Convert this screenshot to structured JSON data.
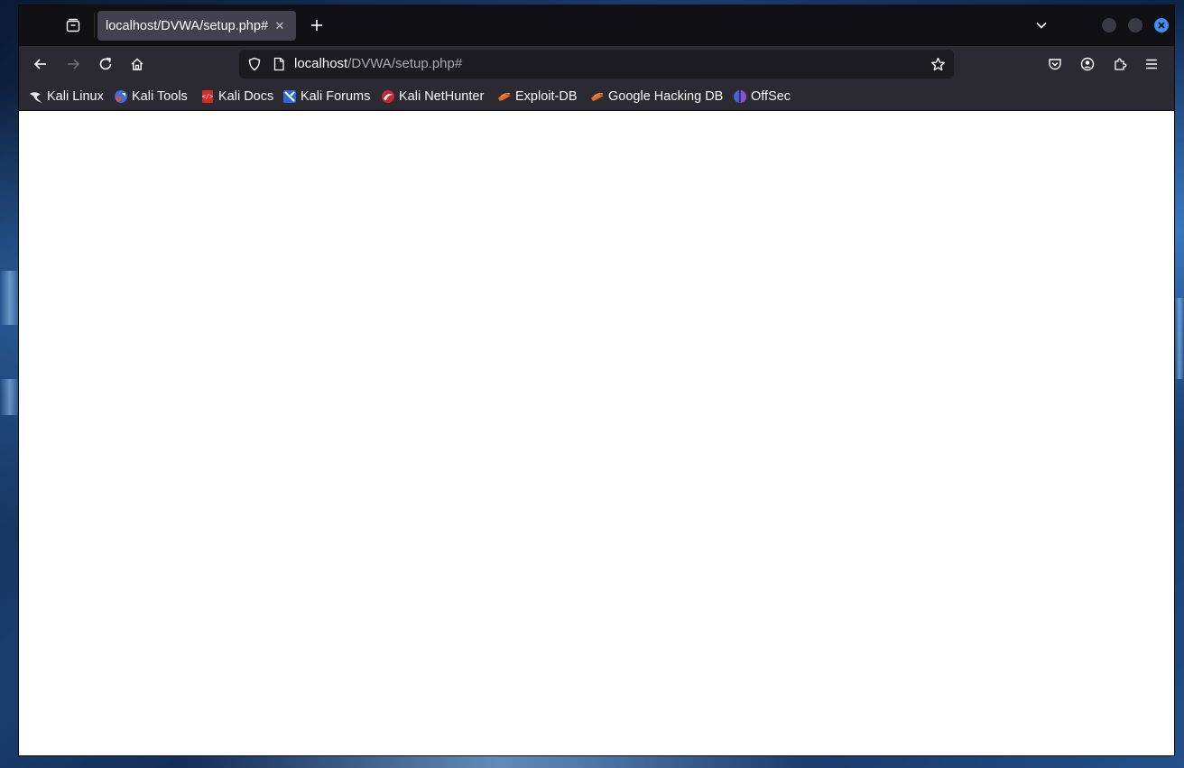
{
  "browser": {
    "tab": {
      "title": "localhost/DVWA/setup.php#",
      "close_label": "✕"
    },
    "new_tab_label": "+",
    "url": {
      "host": "localhost",
      "path": "/DVWA/setup.php#"
    },
    "bookmarks": [
      {
        "label": "Kali Linux",
        "icon": "kali-dragon-icon"
      },
      {
        "label": "Kali Tools",
        "icon": "kali-tools-icon"
      },
      {
        "label": "Kali Docs",
        "icon": "kali-docs-icon"
      },
      {
        "label": "Kali Forums",
        "icon": "kali-forums-icon"
      },
      {
        "label": "Kali NetHunter",
        "icon": "kali-nethunter-icon"
      },
      {
        "label": "Exploit-DB",
        "icon": "exploit-db-icon"
      },
      {
        "label": "Google Hacking DB",
        "icon": "google-hacking-db-icon"
      },
      {
        "label": "OffSec",
        "icon": "offsec-icon"
      }
    ]
  },
  "colors": {
    "tabbar": "#0f0f14",
    "toolbar": "#2b2a33",
    "urlbar": "#1c1b22",
    "close_button": "#3f8ef2"
  }
}
